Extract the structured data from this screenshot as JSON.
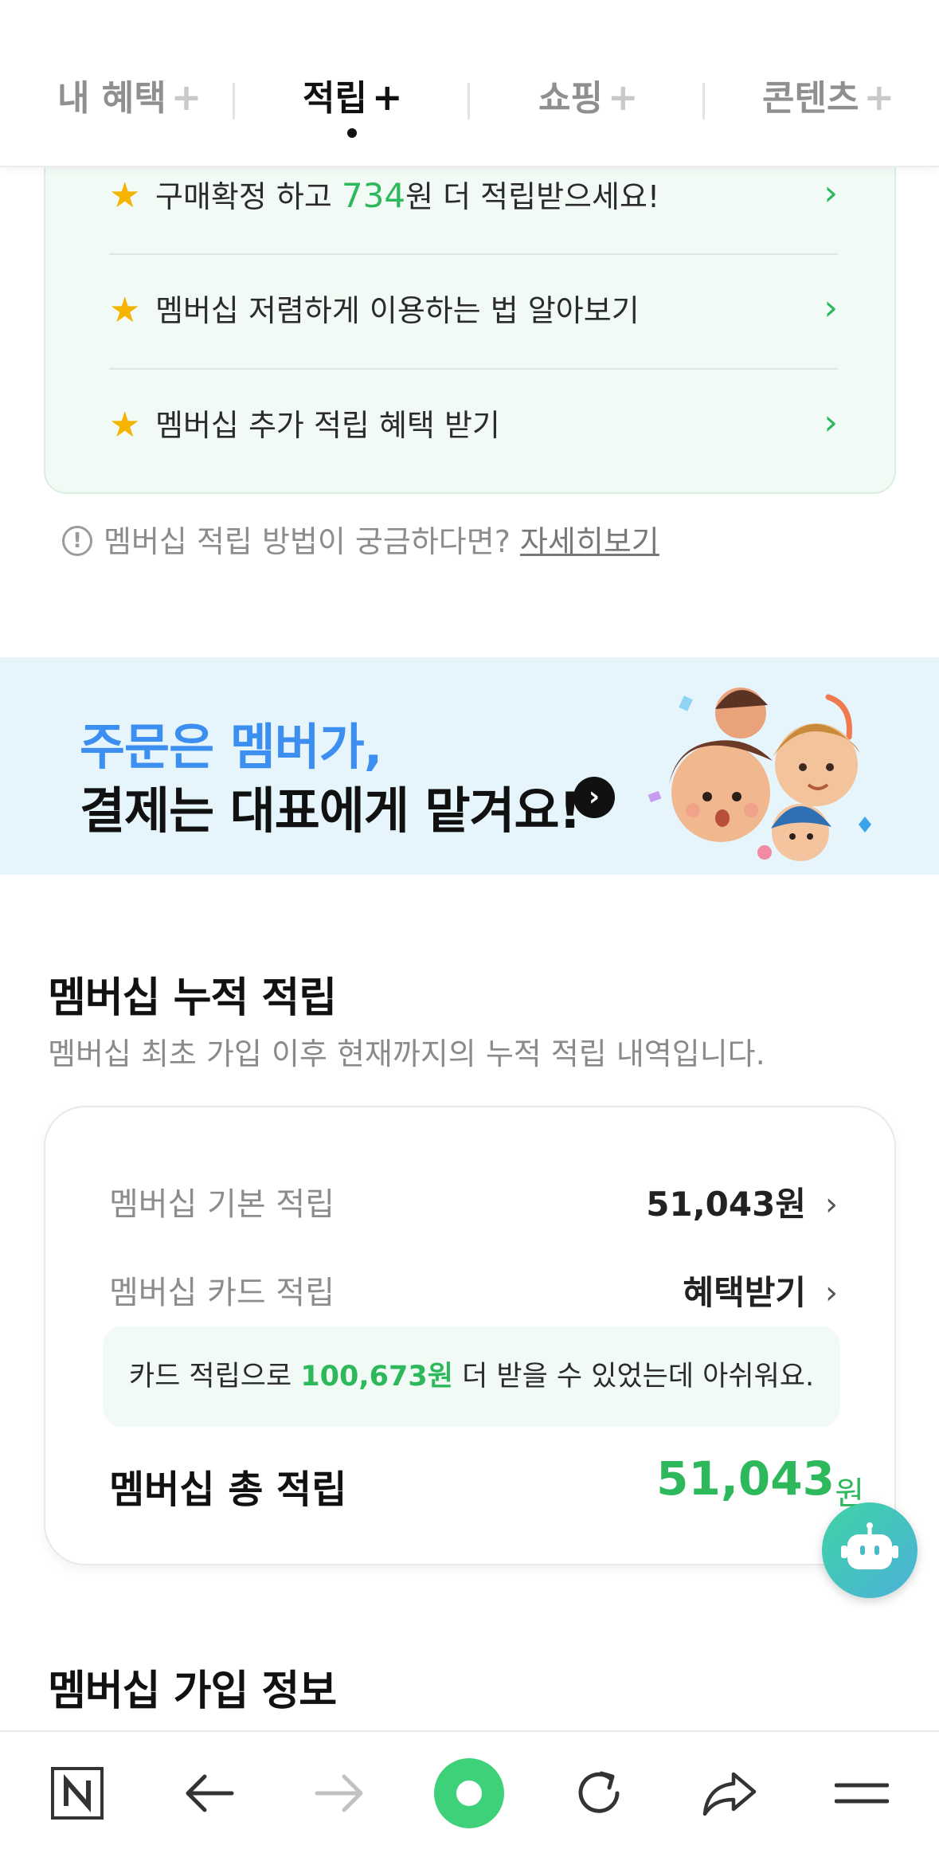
{
  "tabs": [
    {
      "label": "내 혜택",
      "plus": "+"
    },
    {
      "label": "적립",
      "plus": "+"
    },
    {
      "label": "쇼핑",
      "plus": "+"
    },
    {
      "label": "콘텐츠",
      "plus": "+"
    }
  ],
  "active_tab": "적립",
  "tips": [
    {
      "prefix": "구매확정 하고 ",
      "highlight": "734",
      "suffix": "원 더 적립받으세요!"
    },
    {
      "prefix": "멤버십 저렴하게 이용하는 법 알아보기",
      "highlight": "",
      "suffix": ""
    },
    {
      "prefix": "멤버십 추가 적립 혜택 받기",
      "highlight": "",
      "suffix": ""
    }
  ],
  "help": {
    "icon": "!",
    "text": "멤버십 적립 방법이 궁금하다면? ",
    "link": "자세히보기"
  },
  "banner": {
    "line1": "주문은 멤버가,",
    "line2": "결제는 대표에게 맡겨요!"
  },
  "accumulation": {
    "title": "멤버십 누적 적립",
    "subtitle": "멤버십 최초 가입 이후 현재까지의 누적 적립 내역입니다.",
    "rows": [
      {
        "label": "멤버십 기본 적립",
        "value": "51,043원"
      },
      {
        "label": "멤버십 카드 적립",
        "value": "혜택받기"
      }
    ],
    "notice": {
      "prefix": "카드 적립으로 ",
      "amount": "100,673원",
      "suffix": " 더 받을 수 있었는데 아쉬워요."
    },
    "total_label": "멤버십 총 적립",
    "total_value": "51,043",
    "total_unit": "원"
  },
  "signup": {
    "title": "멤버십 가입 정보"
  },
  "colors": {
    "accent_green": "#2db85b",
    "banner_blue": "#3c8ef0",
    "banner_bg": "#e6f5fb",
    "tip_bg": "#f1faf4"
  },
  "toolbar_icons": [
    "naver-home-icon",
    "back-arrow-icon",
    "forward-arrow-icon",
    "green-dot-icon",
    "refresh-icon",
    "share-icon",
    "menu-icon"
  ]
}
